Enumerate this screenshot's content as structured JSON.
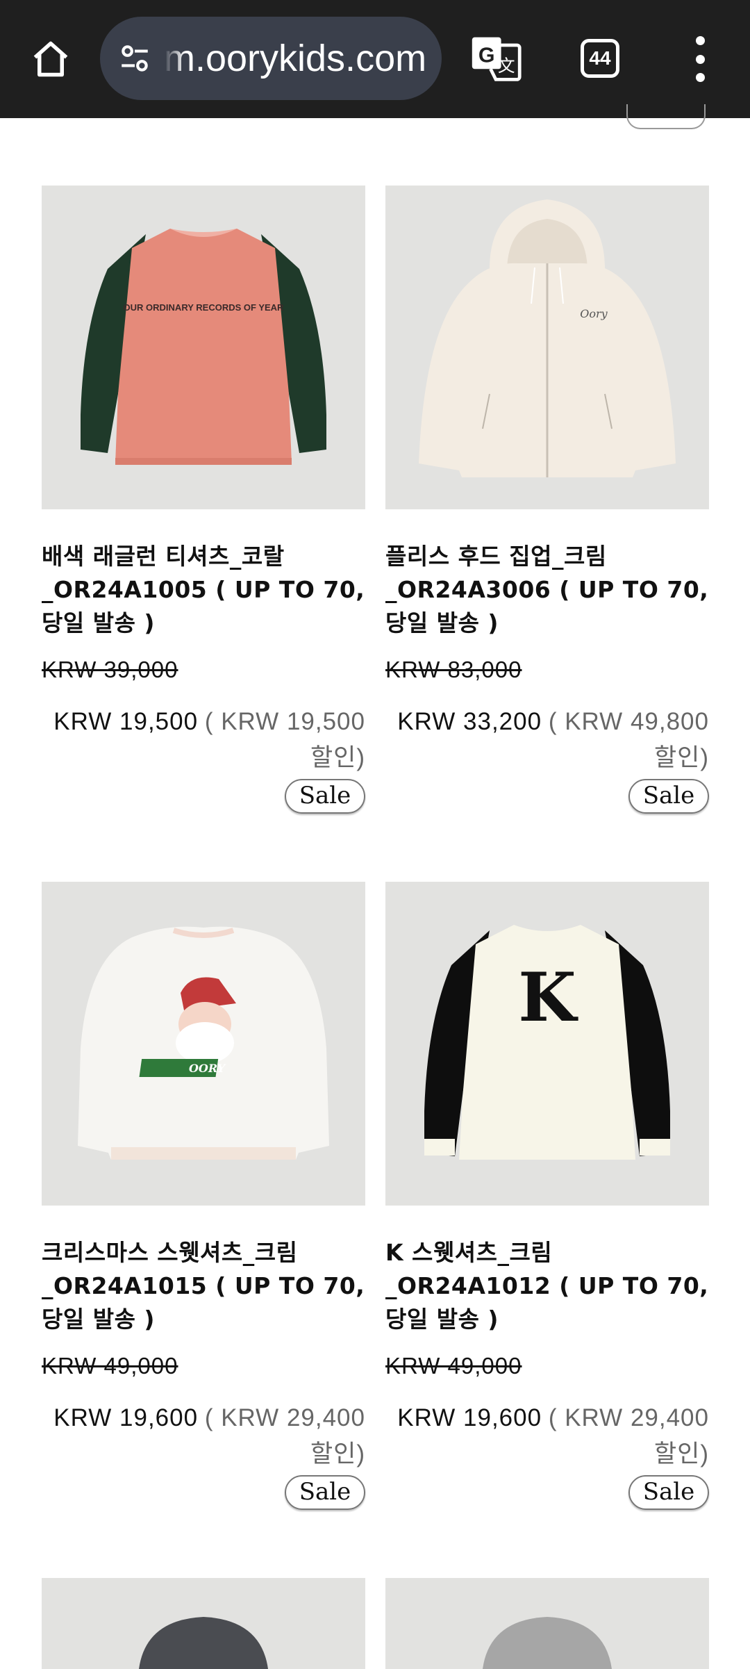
{
  "browser": {
    "url": "m.oorykids.com",
    "tab_count": "44",
    "icons": [
      "home-icon",
      "site-settings-icon",
      "translate-icon",
      "tab-switcher-icon",
      "more-vert-icon"
    ]
  },
  "products": [
    {
      "name": "배색 래글런 티셔츠_코랄_OR24A1005 ( UP TO 70, 당일 발송 )",
      "original_price": "KRW 39,000",
      "sale_price": "KRW 19,500",
      "discount_text": "( KRW 19,500 할인)",
      "badge": "Sale",
      "image_text": "OUR ORDINARY RECORDS OF YEAR"
    },
    {
      "name": "플리스 후드 집업_크림_OR24A3006 ( UP TO 70, 당일 발송 )",
      "original_price": "KRW 83,000",
      "sale_price": "KRW 33,200",
      "discount_text": "( KRW 49,800 할인)",
      "badge": "Sale",
      "image_text": "Oory"
    },
    {
      "name": "크리스마스 스웻셔츠_크림_OR24A1015 ( UP TO 70, 당일 발송 )",
      "original_price": "KRW 49,000",
      "sale_price": "KRW 19,600",
      "discount_text": "( KRW 29,400 할인)",
      "badge": "Sale",
      "image_text": "OORY"
    },
    {
      "name": "K 스웻셔츠_크림_OR24A1012 ( UP TO 70, 당일 발송 )",
      "original_price": "KRW 49,000",
      "sale_price": "KRW 19,600",
      "discount_text": "( KRW 29,400 할인)",
      "badge": "Sale",
      "image_text": "K"
    }
  ],
  "colors": {
    "toolbar_bg": "#1f1f1f",
    "url_pill_bg": "#3a3f4b",
    "image_bg": "#e2e2e0",
    "coral": "#e58a7a",
    "dark_green": "#1f3a2a",
    "cream": "#f3ece2"
  }
}
